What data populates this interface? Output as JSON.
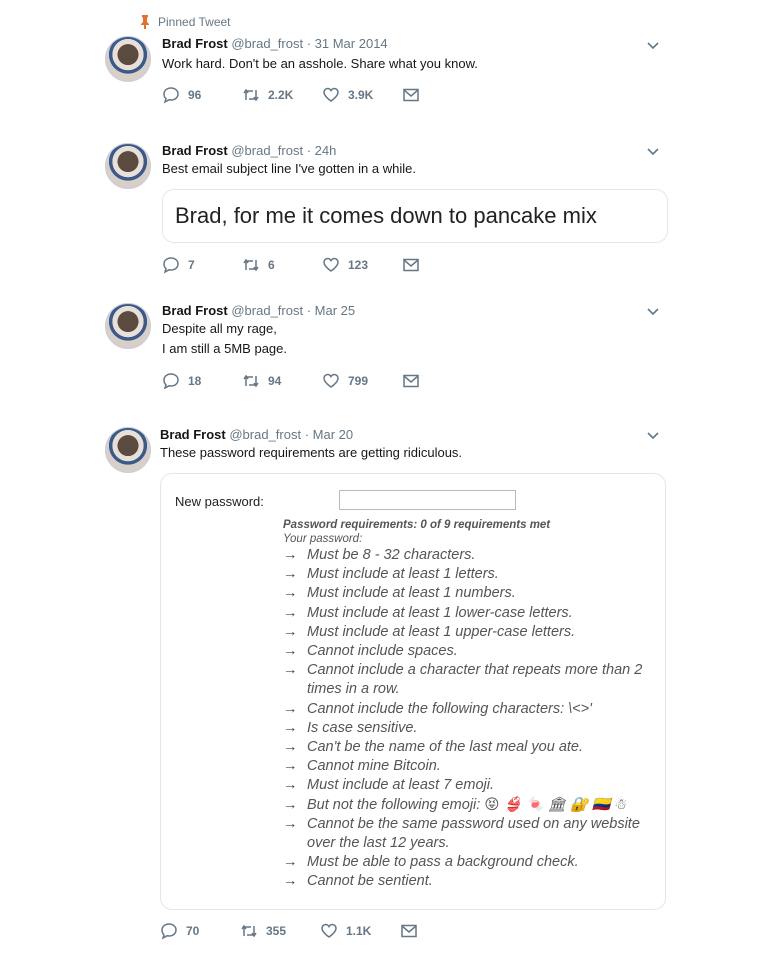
{
  "pinned_label": "Pinned Tweet",
  "colors": {
    "pin": "#e0732e",
    "meta": "#657786",
    "text": "#14171a"
  },
  "tweets": [
    {
      "name": "Brad Frost",
      "handle": "@brad_frost",
      "sep": " · ",
      "date": "31 Mar 2014",
      "text": "Work hard. Don't be an asshole. Share what you know.",
      "replies": "96",
      "retweets": "2.2K",
      "likes": "3.9K"
    },
    {
      "name": "Brad Frost",
      "handle": "@brad_frost",
      "sep": " · ",
      "date": "24h",
      "text": "Best email subject line I've gotten in a while.",
      "card_text": "Brad, for me it comes down to pancake mix",
      "replies": "7",
      "retweets": "6",
      "likes": "123"
    },
    {
      "name": "Brad Frost",
      "handle": "@brad_frost",
      "sep": " · ",
      "date": "Mar 25",
      "text_line1": "Despite all my rage,",
      "text_line2": "I am still a 5MB page.",
      "replies": "18",
      "retweets": "94",
      "likes": "799"
    },
    {
      "name": "Brad Frost",
      "handle": "@brad_frost",
      "sep": " · ",
      "date": "Mar 20",
      "text": "These password requirements are getting ridiculous.",
      "replies": "70",
      "retweets": "355",
      "likes": "1.1K"
    }
  ],
  "password": {
    "label": "New password:",
    "value": "",
    "title": "Password requirements: 0 of 9 requirements met",
    "subtitle": "Your password:",
    "arrow": "→",
    "requirements": [
      "Must be 8 - 32 characters.",
      "Must include at least 1 letters.",
      "Must include at least 1 numbers.",
      "Must include at least 1 lower-case letters.",
      "Must include at least 1 upper-case letters.",
      "Cannot include spaces.",
      "Cannot include a character that repeats more than 2 times in a row.",
      "Cannot include the following characters: \\<>'",
      "Is case sensitive.",
      "Can't be the name of the last meal you ate.",
      "Cannot mine Bitcoin.",
      "Must include at least 7 emoji.",
      "But not the following emoji: 😝 👙 🍬 🏛 🔐 🇨🇴 ☃",
      "Cannot be the same password used on any website over the last 12 years.",
      "Must be able to pass a background check.",
      "Cannot be sentient."
    ]
  }
}
